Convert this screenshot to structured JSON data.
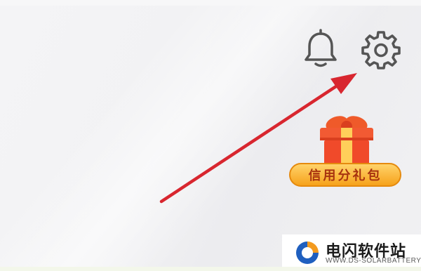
{
  "header": {
    "notifications_icon": "bell-icon",
    "settings_icon": "gear-icon"
  },
  "annotation": {
    "arrow_color": "#d8262f",
    "points_to": "settings"
  },
  "promo": {
    "icon": "gift-box-icon",
    "label": "信用分礼包"
  },
  "watermark": {
    "title": "电闪软件站",
    "subtitle": "WWW.DS-SOLARBATTERY.COM"
  },
  "colors": {
    "icon_stroke": "#555555",
    "gift_red": "#f04a2a",
    "badge_gold": "#f6a21b",
    "badge_text": "#a8330f"
  }
}
